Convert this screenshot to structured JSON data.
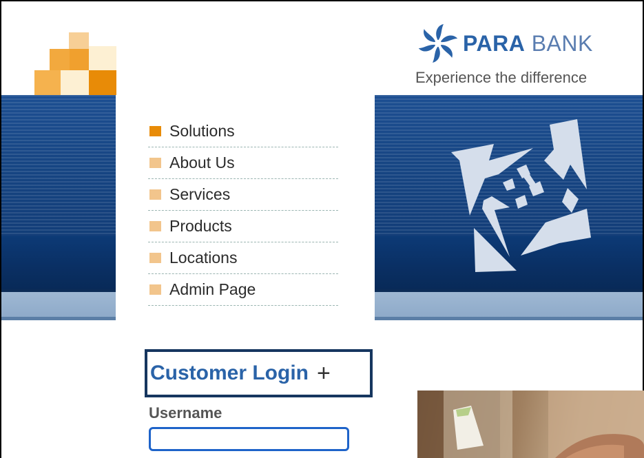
{
  "brand": {
    "name_bold": "PARA",
    "name_light": "BANK",
    "tagline": "Experience the difference"
  },
  "nav": {
    "items": [
      {
        "label": "Solutions",
        "active": true
      },
      {
        "label": "About Us",
        "active": false
      },
      {
        "label": "Services",
        "active": false
      },
      {
        "label": "Products",
        "active": false
      },
      {
        "label": "Locations",
        "active": false
      },
      {
        "label": "Admin Page",
        "active": false
      }
    ]
  },
  "login": {
    "title": "Customer Login",
    "expand_symbol": "+",
    "username_label": "Username",
    "username_value": ""
  },
  "icons": {
    "logo": "parabank-flower-logo-icon",
    "banner_graphic": "arrows-pinwheel-icon",
    "corner_squares": "orange-squares-logo-icon"
  },
  "colors": {
    "accent_orange": "#e88b07",
    "bullet_light": "#f2c58c",
    "brand_blue": "#2a63a8",
    "banner_blue": "#174684",
    "focus_blue": "#1e63c9"
  }
}
